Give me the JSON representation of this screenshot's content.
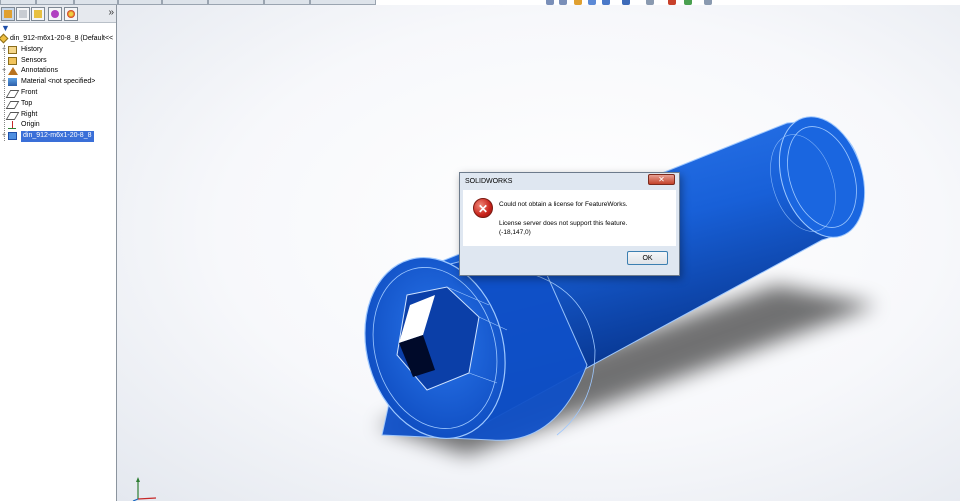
{
  "colors": {
    "panel_border": "#8b949e",
    "selection": "#3a6fd8",
    "model_blue": "#1a66e0",
    "model_edge": "#9ec8ff",
    "dialog_frame": "#dfe7f1",
    "close_red": "#c4432b"
  },
  "feature_manager": {
    "expand_glyph": "»",
    "filter_icon": "filter-icon",
    "root_label": "din_912-m6x1-20-8_8  (Default<<",
    "items": [
      {
        "label": "History",
        "icon": "history-icon",
        "expander": "+"
      },
      {
        "label": "Sensors",
        "icon": "sensors-icon",
        "expander": ""
      },
      {
        "label": "Annotations",
        "icon": "annotations-icon",
        "expander": "+"
      },
      {
        "label": "Material <not specified>",
        "icon": "material-icon",
        "expander": "+"
      },
      {
        "label": "Front",
        "icon": "plane-icon",
        "expander": ""
      },
      {
        "label": "Top",
        "icon": "plane-icon",
        "expander": ""
      },
      {
        "label": "Right",
        "icon": "plane-icon",
        "expander": ""
      },
      {
        "label": "Origin",
        "icon": "origin-icon",
        "expander": ""
      },
      {
        "label": "din_912-m6x1-20-8_8",
        "icon": "body-icon",
        "expander": "+",
        "selected": true
      }
    ]
  },
  "dialog": {
    "title": "SOLIDWORKS",
    "close_glyph": "✕",
    "icon": "error-icon",
    "icon_glyph": "✕",
    "message": "Could not obtain a license for FeatureWorks.",
    "detail_line1": "License server does not support this feature.",
    "detail_line2": "(-18,147,0)",
    "ok_label": "OK"
  }
}
